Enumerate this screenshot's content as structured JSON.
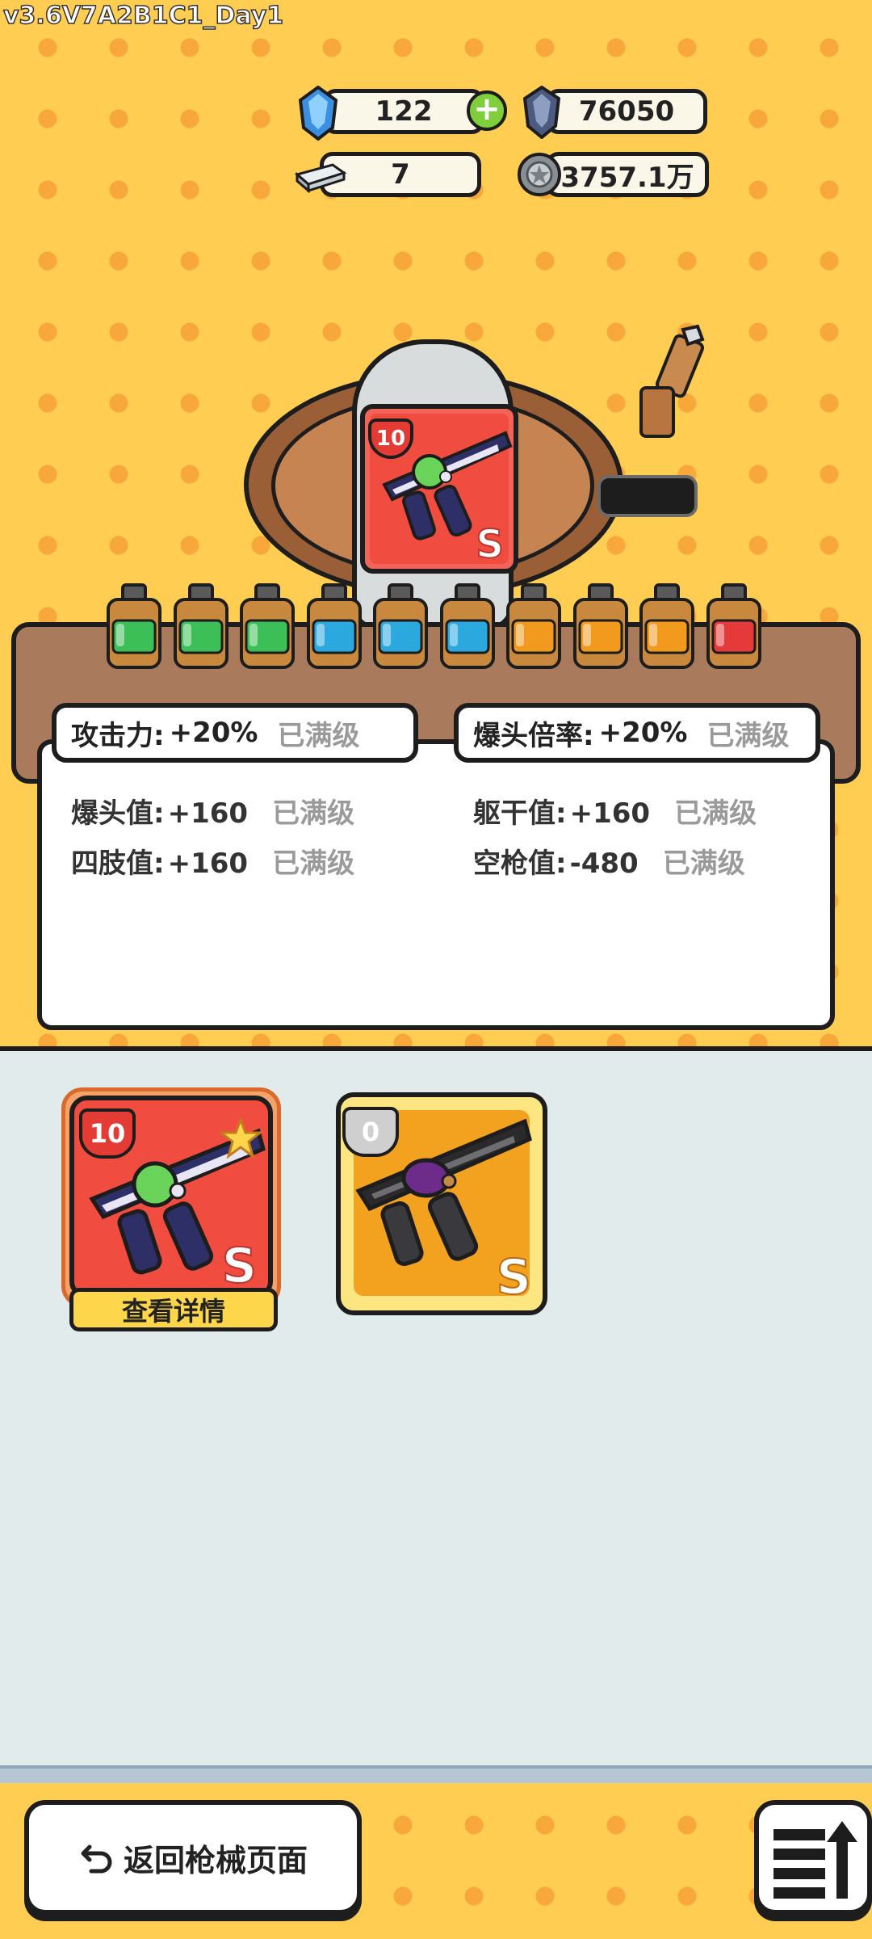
{
  "version": "v3.6V7A2B1C1_Day1",
  "currencies": {
    "gem": {
      "icon": "blue-crystal-icon",
      "value": "122"
    },
    "dark_crystal": {
      "icon": "dark-crystal-icon",
      "value": "76050"
    },
    "silver_bar": {
      "icon": "silver-bar-icon",
      "value": "7"
    },
    "coin": {
      "icon": "coin-icon",
      "value": "3757.1万"
    },
    "add_icon": "plus-icon"
  },
  "featured_weapon": {
    "level": "10",
    "grade": "S",
    "icon": "rifle-icon"
  },
  "bottles": [
    {
      "color": "#3cbf56"
    },
    {
      "color": "#3cbf56"
    },
    {
      "color": "#3cbf56"
    },
    {
      "color": "#2ba8de"
    },
    {
      "color": "#2ba8de"
    },
    {
      "color": "#2ba8de"
    },
    {
      "color": "#f29a1e"
    },
    {
      "color": "#f29a1e"
    },
    {
      "color": "#f29a1e"
    },
    {
      "color": "#e53a3a"
    }
  ],
  "highlight_stats": [
    {
      "label": "攻击力:",
      "value": "+20%",
      "status": "已满级"
    },
    {
      "label": "爆头倍率:",
      "value": "+20%",
      "status": "已满级"
    }
  ],
  "stats": [
    {
      "label": "爆头值:",
      "value": "+160",
      "status": "已满级"
    },
    {
      "label": "躯干值:",
      "value": "+160",
      "status": "已满级"
    },
    {
      "label": "四肢值:",
      "value": "+160",
      "status": "已满级"
    },
    {
      "label": "空枪值:",
      "value": "-480",
      "status": "已满级"
    }
  ],
  "inventory": [
    {
      "level": "10",
      "grade": "S",
      "selected": true,
      "button": "查看详情",
      "star": "star-icon"
    },
    {
      "level": "0",
      "grade": "S",
      "selected": false
    }
  ],
  "footer": {
    "back_label": "返回枪械页面",
    "back_icon": "return-arrow-icon",
    "menu_icon": "sort-menu-icon"
  },
  "colors": {
    "background": "#fecd52",
    "dots": "#f8a73a",
    "lower_bg": "#e2ebec",
    "card_red": "#f04c40",
    "card_gold": "#f3a21f"
  }
}
